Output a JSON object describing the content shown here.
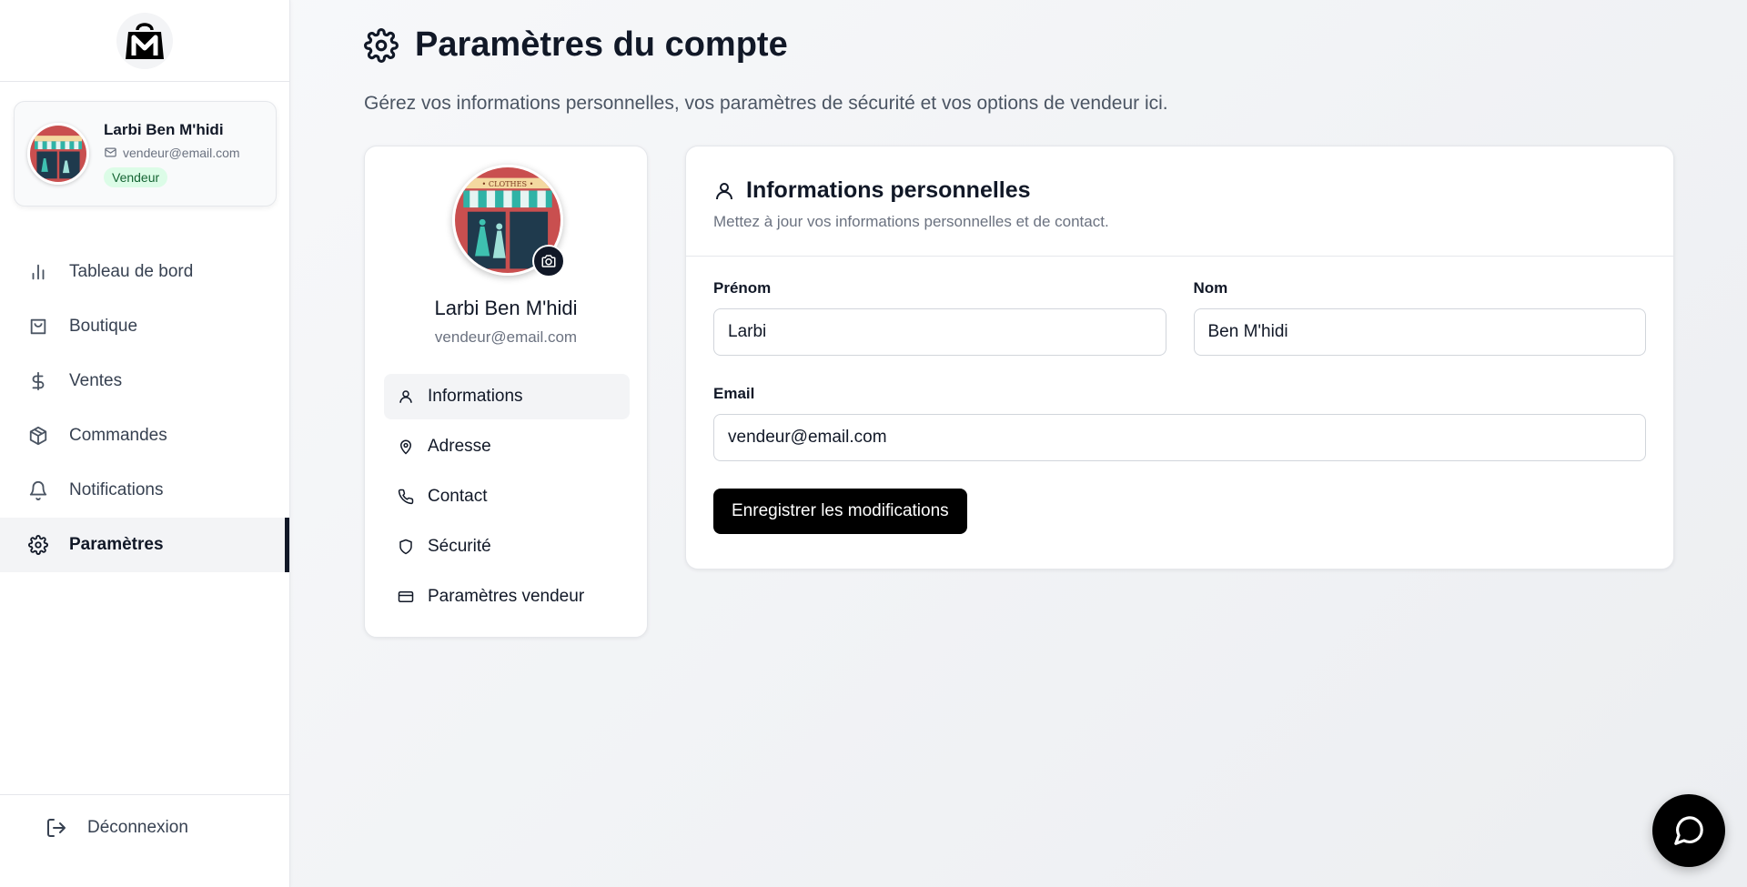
{
  "brand": {
    "logo_icon": "shopping-bag-m-logo"
  },
  "user": {
    "name": "Larbi Ben M'hidi",
    "email": "vendeur@email.com",
    "role": "Vendeur"
  },
  "sidebar": {
    "items": [
      {
        "label": "Tableau de bord",
        "icon": "bar-chart-icon"
      },
      {
        "label": "Boutique",
        "icon": "shopping-bag-icon"
      },
      {
        "label": "Ventes",
        "icon": "dollar-icon"
      },
      {
        "label": "Commandes",
        "icon": "package-icon"
      },
      {
        "label": "Notifications",
        "icon": "bell-icon"
      },
      {
        "label": "Paramètres",
        "icon": "gear-icon",
        "active": true
      }
    ],
    "logout_label": "Déconnexion"
  },
  "page": {
    "title": "Paramètres du compte",
    "subtitle": "Gérez vos informations personnelles, vos paramètres de sécurité et vos options de vendeur ici."
  },
  "settings_menu": {
    "items": [
      {
        "label": "Informations",
        "icon": "user-icon",
        "active": true
      },
      {
        "label": "Adresse",
        "icon": "map-pin-icon"
      },
      {
        "label": "Contact",
        "icon": "phone-icon"
      },
      {
        "label": "Sécurité",
        "icon": "shield-icon"
      },
      {
        "label": "Paramètres vendeur",
        "icon": "credit-card-icon"
      }
    ]
  },
  "personal_info": {
    "title": "Informations personnelles",
    "description": "Mettez à jour vos informations personnelles et de contact.",
    "first_name_label": "Prénom",
    "first_name_value": "Larbi",
    "last_name_label": "Nom",
    "last_name_value": "Ben M'hidi",
    "email_label": "Email",
    "email_value": "vendeur@email.com",
    "save_label": "Enregistrer les modifications"
  },
  "colors": {
    "primary": "#000000",
    "badge_bg": "#dcfce7",
    "badge_text": "#166534",
    "active_bg": "#f3f4f6"
  }
}
